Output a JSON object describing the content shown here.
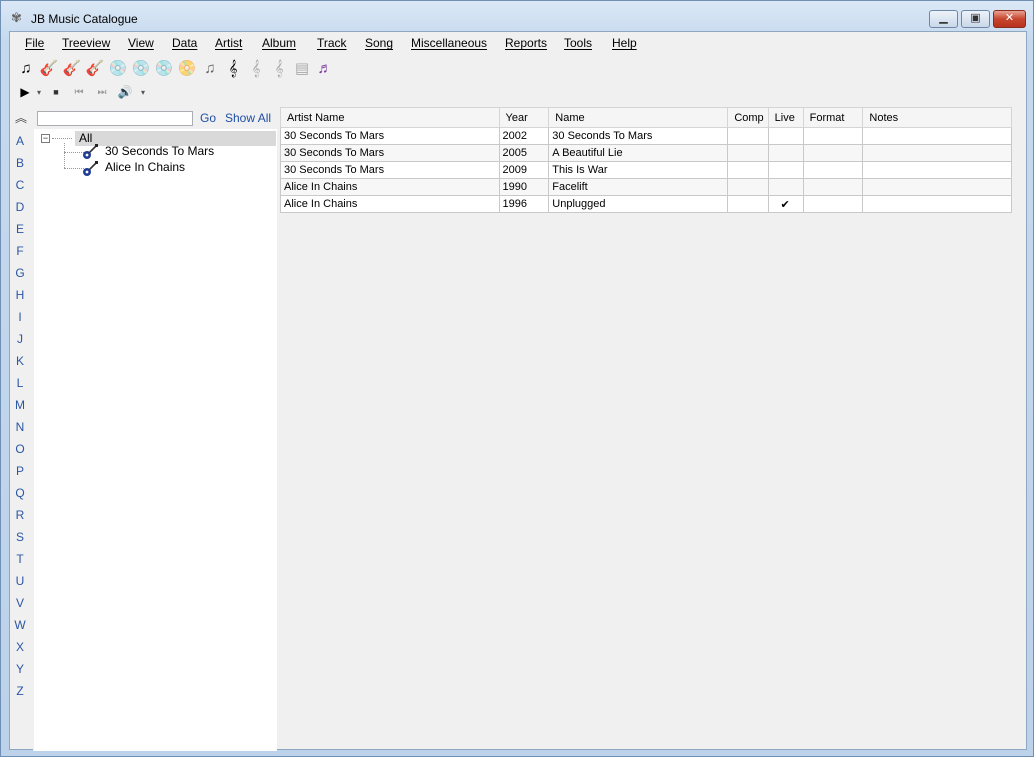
{
  "window": {
    "title": "JB Music Catalogue",
    "controls": {
      "minimize": "▁",
      "maximize": "▣",
      "close": "✕"
    }
  },
  "menu": {
    "items": [
      "File",
      "Treeview",
      "View",
      "Data",
      "Artist",
      "Album",
      "Track",
      "Song",
      "Miscellaneous",
      "Reports",
      "Tools",
      "Help"
    ]
  },
  "toolbar": {
    "buttons": [
      {
        "icon": "add-artist-icon",
        "glyph": "♫",
        "enabled": true
      },
      {
        "icon": "edit-artist-guitar-icon",
        "glyph": "🎸",
        "enabled": true
      },
      {
        "icon": "delete-artist-guitar-icon",
        "glyph": "🎸",
        "enabled": false
      },
      {
        "icon": "artist-list-guitar-icon",
        "glyph": "🎸",
        "enabled": true
      },
      {
        "icon": "add-album-icon",
        "glyph": "💿",
        "enabled": true
      },
      {
        "icon": "edit-album-icon",
        "glyph": "💿",
        "enabled": false
      },
      {
        "icon": "delete-album-icon",
        "glyph": "💿",
        "enabled": false
      },
      {
        "icon": "album-list-icon",
        "glyph": "📀",
        "enabled": true
      },
      {
        "icon": "track-note-icon",
        "glyph": "♫",
        "enabled": true
      },
      {
        "icon": "add-song-icon",
        "glyph": "𝄞",
        "enabled": true
      },
      {
        "icon": "edit-song-icon",
        "glyph": "𝄞",
        "enabled": false
      },
      {
        "icon": "delete-song-icon",
        "glyph": "𝄞",
        "enabled": false
      },
      {
        "icon": "song-notes-icon",
        "glyph": "▤",
        "enabled": false
      },
      {
        "icon": "song-list-icon",
        "glyph": "♬",
        "enabled": true
      }
    ]
  },
  "player": {
    "play": "▶",
    "dropdown": "▾",
    "stop": "■",
    "previous": "⏮",
    "next": "⏭",
    "volume": "🔊"
  },
  "alphabet": {
    "collapse": "︽",
    "letters": [
      "A",
      "B",
      "C",
      "D",
      "E",
      "F",
      "G",
      "H",
      "I",
      "J",
      "K",
      "L",
      "M",
      "N",
      "O",
      "P",
      "Q",
      "R",
      "S",
      "T",
      "U",
      "V",
      "W",
      "X",
      "Y",
      "Z"
    ]
  },
  "tree": {
    "search_value": "",
    "go_label": "Go",
    "show_all_label": "Show All",
    "root_label": "All",
    "expander": "−",
    "children": [
      "30 Seconds To Mars",
      "Alice In Chains"
    ]
  },
  "grid": {
    "columns": [
      "Artist Name",
      "Year",
      "Name",
      "Comp",
      "Live",
      "Format",
      "Notes"
    ],
    "rows": [
      {
        "artist": "30 Seconds To Mars",
        "year": "2002",
        "name": "30 Seconds To Mars",
        "comp": "",
        "live": "",
        "format": "",
        "notes": ""
      },
      {
        "artist": "30 Seconds To Mars",
        "year": "2005",
        "name": "A Beautiful Lie",
        "comp": "",
        "live": "",
        "format": "",
        "notes": ""
      },
      {
        "artist": "30 Seconds To Mars",
        "year": "2009",
        "name": "This Is War",
        "comp": "",
        "live": "",
        "format": "",
        "notes": ""
      },
      {
        "artist": "Alice In Chains",
        "year": "1990",
        "name": "Facelift",
        "comp": "",
        "live": "",
        "format": "",
        "notes": ""
      },
      {
        "artist": "Alice In Chains",
        "year": "1996",
        "name": "Unplugged",
        "comp": "",
        "live": "✔",
        "format": "",
        "notes": ""
      }
    ]
  },
  "colors": {
    "link": "#1f4ea6",
    "alpha": "#2b56a4",
    "selection": "#d9d9d9",
    "close_button": "#c7452e"
  }
}
